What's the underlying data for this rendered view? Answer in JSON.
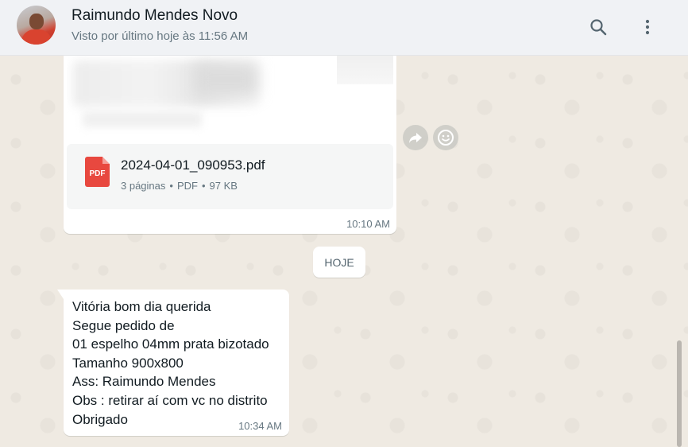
{
  "header": {
    "contact_name": "Raimundo Mendes Novo",
    "status": "Visto por último hoje às 11:56 AM",
    "icons": {
      "search": "search-icon",
      "menu": "vertical-dots-icon"
    }
  },
  "messages": {
    "document": {
      "filename": "2024-04-01_090953.pdf",
      "pages": "3 páginas",
      "type": "PDF",
      "size": "97 KB",
      "time": "10:10 AM",
      "icon_label": "PDF"
    },
    "date_divider": "HOJE",
    "text_message": {
      "lines": [
        "Vitória bom dia querida",
        "Segue pedido de",
        "01 espelho 04mm prata bizotado",
        "Tamanho 900x800",
        "Ass: Raimundo Mendes",
        "Obs : retirar aí com vc no distrito",
        "Obrigado"
      ],
      "time": "10:34 AM"
    }
  },
  "colors": {
    "wallpaper": "#efeae2",
    "header_bg": "#f0f2f5",
    "pdf_red": "#e8483f",
    "meta_gray": "#667781"
  }
}
